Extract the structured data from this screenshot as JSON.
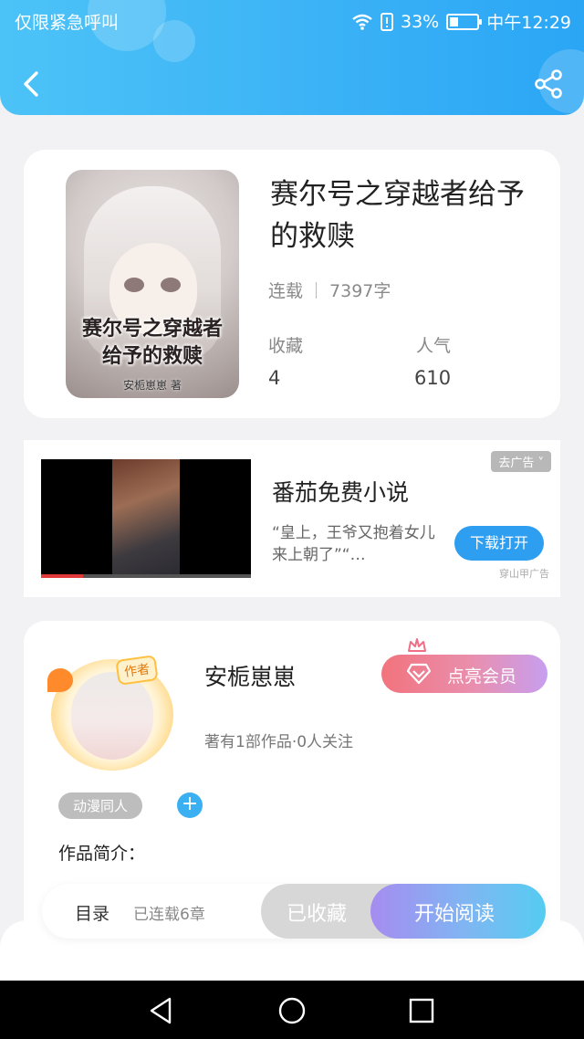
{
  "status_bar": {
    "carrier": "仅限紧急呼叫",
    "battery_percent": "33%",
    "time": "中午12:29",
    "battery_level": 0.33
  },
  "book": {
    "title": "赛尔号之穿越者给予的救赎",
    "status": "连载",
    "word_count": "7397字",
    "cover_title_line1": "赛尔号之穿越者",
    "cover_title_line2": "给予的救赎",
    "cover_author": "安栀崽崽 著",
    "stats": [
      {
        "label": "收藏",
        "value": "4"
      },
      {
        "label": "人气",
        "value": "610"
      }
    ]
  },
  "ad": {
    "badge": "去广告 ˅",
    "title": "番茄免费小说",
    "description": "“皇上，王爷又抱着女儿来上朝了”“…",
    "button": "下载打开",
    "source": "穿山甲广告",
    "video_progress": 0.2
  },
  "author": {
    "name": "安栀崽崽",
    "avatar_tag": "作者",
    "vip_button": "点亮会员",
    "stats": "著有1部作品·0人关注",
    "tag": "动漫同人",
    "add_tag": "+",
    "intro_label": "作品简介："
  },
  "action_bar": {
    "toc": "目录",
    "chapters": "已连载6章",
    "collected": "已收藏",
    "read": "开始阅读"
  },
  "colors": {
    "header": "#3ab1f6",
    "accent_blue": "#2e9ef0",
    "vip_pink": "#f2737d"
  }
}
